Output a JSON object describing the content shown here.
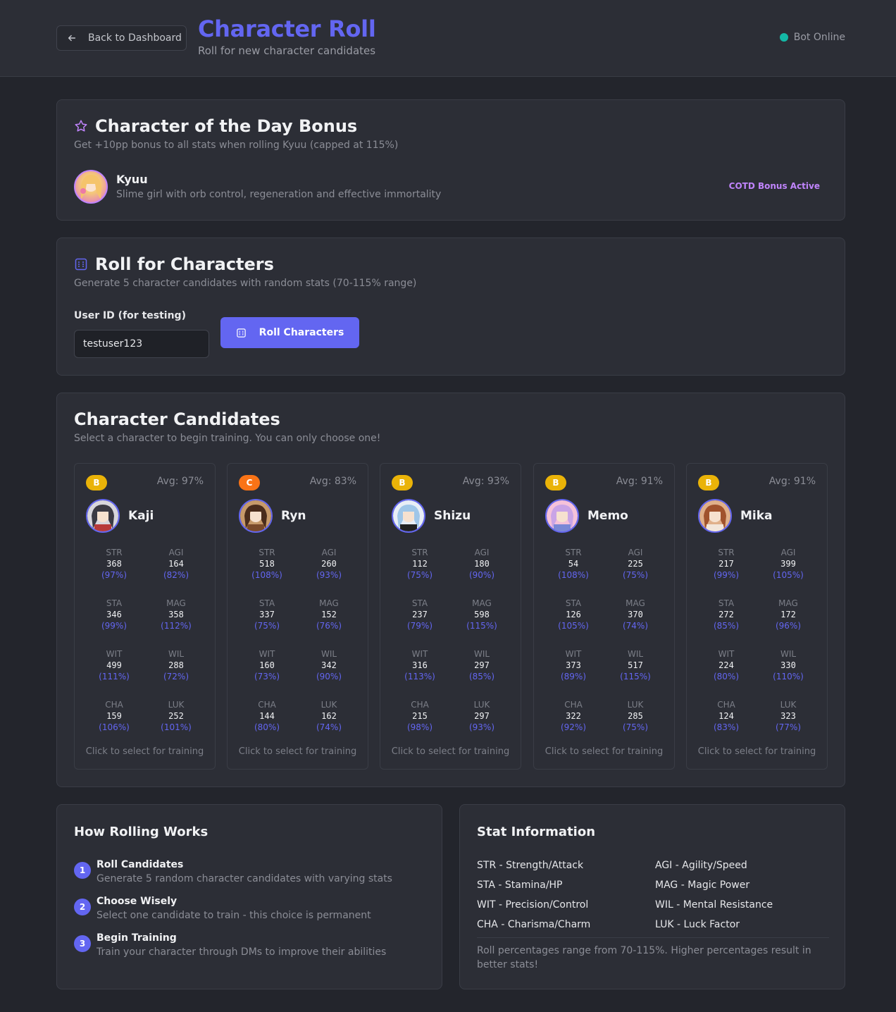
{
  "header": {
    "back_label": "Back to Dashboard",
    "title": "Character Roll",
    "subtitle": "Roll for new character candidates",
    "status": "Bot Online",
    "status_color": "#14b8a6"
  },
  "cotd": {
    "title": "Character of the Day Bonus",
    "description": "Get +10pp bonus to all stats when rolling Kyuu (capped at 115%)",
    "name": "Kyuu",
    "character_description": "Slime girl with orb control, regeneration and effective immortality",
    "badge": "COTD Bonus Active"
  },
  "roll": {
    "title": "Roll for Characters",
    "description": "Generate 5 character candidates with random stats (70-115% range)",
    "input_label": "User ID (for testing)",
    "input_value": "testuser123",
    "button_label": "Roll Characters"
  },
  "candidates": {
    "title": "Character Candidates",
    "description": "Select a character to begin training. You can only choose one!",
    "hint": "Click to select for training",
    "items": [
      {
        "tier": "B",
        "tier_color": "#eab308",
        "avg": "Avg: 97%",
        "name": "Kaji",
        "stats": [
          {
            "label": "STR",
            "value": "368",
            "pct": "(97%)"
          },
          {
            "label": "AGI",
            "value": "164",
            "pct": "(82%)"
          },
          {
            "label": "STA",
            "value": "346",
            "pct": "(99%)"
          },
          {
            "label": "MAG",
            "value": "358",
            "pct": "(112%)"
          },
          {
            "label": "WIT",
            "value": "499",
            "pct": "(111%)"
          },
          {
            "label": "WIL",
            "value": "288",
            "pct": "(72%)"
          },
          {
            "label": "CHA",
            "value": "159",
            "pct": "(106%)"
          },
          {
            "label": "LUK",
            "value": "252",
            "pct": "(101%)"
          }
        ]
      },
      {
        "tier": "C",
        "tier_color": "#f97316",
        "avg": "Avg: 83%",
        "name": "Ryn",
        "stats": [
          {
            "label": "STR",
            "value": "518",
            "pct": "(108%)"
          },
          {
            "label": "AGI",
            "value": "260",
            "pct": "(93%)"
          },
          {
            "label": "STA",
            "value": "337",
            "pct": "(75%)"
          },
          {
            "label": "MAG",
            "value": "152",
            "pct": "(76%)"
          },
          {
            "label": "WIT",
            "value": "160",
            "pct": "(73%)"
          },
          {
            "label": "WIL",
            "value": "342",
            "pct": "(90%)"
          },
          {
            "label": "CHA",
            "value": "144",
            "pct": "(80%)"
          },
          {
            "label": "LUK",
            "value": "162",
            "pct": "(74%)"
          }
        ]
      },
      {
        "tier": "B",
        "tier_color": "#eab308",
        "avg": "Avg: 93%",
        "name": "Shizu",
        "stats": [
          {
            "label": "STR",
            "value": "112",
            "pct": "(75%)"
          },
          {
            "label": "AGI",
            "value": "180",
            "pct": "(90%)"
          },
          {
            "label": "STA",
            "value": "237",
            "pct": "(79%)"
          },
          {
            "label": "MAG",
            "value": "598",
            "pct": "(115%)"
          },
          {
            "label": "WIT",
            "value": "316",
            "pct": "(113%)"
          },
          {
            "label": "WIL",
            "value": "297",
            "pct": "(85%)"
          },
          {
            "label": "CHA",
            "value": "215",
            "pct": "(98%)"
          },
          {
            "label": "LUK",
            "value": "297",
            "pct": "(93%)"
          }
        ]
      },
      {
        "tier": "B",
        "tier_color": "#eab308",
        "avg": "Avg: 91%",
        "name": "Memo",
        "stats": [
          {
            "label": "STR",
            "value": "54",
            "pct": "(108%)"
          },
          {
            "label": "AGI",
            "value": "225",
            "pct": "(75%)"
          },
          {
            "label": "STA",
            "value": "126",
            "pct": "(105%)"
          },
          {
            "label": "MAG",
            "value": "370",
            "pct": "(74%)"
          },
          {
            "label": "WIT",
            "value": "373",
            "pct": "(89%)"
          },
          {
            "label": "WIL",
            "value": "517",
            "pct": "(115%)"
          },
          {
            "label": "CHA",
            "value": "322",
            "pct": "(92%)"
          },
          {
            "label": "LUK",
            "value": "285",
            "pct": "(75%)"
          }
        ]
      },
      {
        "tier": "B",
        "tier_color": "#eab308",
        "avg": "Avg: 91%",
        "name": "Mika",
        "stats": [
          {
            "label": "STR",
            "value": "217",
            "pct": "(99%)"
          },
          {
            "label": "AGI",
            "value": "399",
            "pct": "(105%)"
          },
          {
            "label": "STA",
            "value": "272",
            "pct": "(85%)"
          },
          {
            "label": "MAG",
            "value": "172",
            "pct": "(96%)"
          },
          {
            "label": "WIT",
            "value": "224",
            "pct": "(80%)"
          },
          {
            "label": "WIL",
            "value": "330",
            "pct": "(110%)"
          },
          {
            "label": "CHA",
            "value": "124",
            "pct": "(83%)"
          },
          {
            "label": "LUK",
            "value": "323",
            "pct": "(77%)"
          }
        ]
      }
    ]
  },
  "how": {
    "title": "How Rolling Works",
    "steps": [
      {
        "num": "1",
        "title": "Roll Candidates",
        "desc": "Generate 5 random character candidates with varying stats"
      },
      {
        "num": "2",
        "title": "Choose Wisely",
        "desc": "Select one candidate to train - this choice is permanent"
      },
      {
        "num": "3",
        "title": "Begin Training",
        "desc": "Train your character through DMs to improve their abilities"
      }
    ]
  },
  "statinfo": {
    "title": "Stat Information",
    "items": [
      "STR - Strength/Attack",
      "AGI - Agility/Speed",
      "STA - Stamina/HP",
      "MAG - Magic Power",
      "WIT - Precision/Control",
      "WIL - Mental Resistance",
      "CHA - Charisma/Charm",
      "LUK - Luck Factor"
    ],
    "note": "Roll percentages range from 70-115%. Higher percentages result in better stats!"
  },
  "colors": {
    "accent": "#6366f1",
    "cotd_accent": "#c084fc",
    "background": "#23252c",
    "card": "#2c2e36"
  },
  "icons": {
    "back": "arrow-left-icon",
    "cotd": "star-icon",
    "roll": "dice-icon"
  }
}
